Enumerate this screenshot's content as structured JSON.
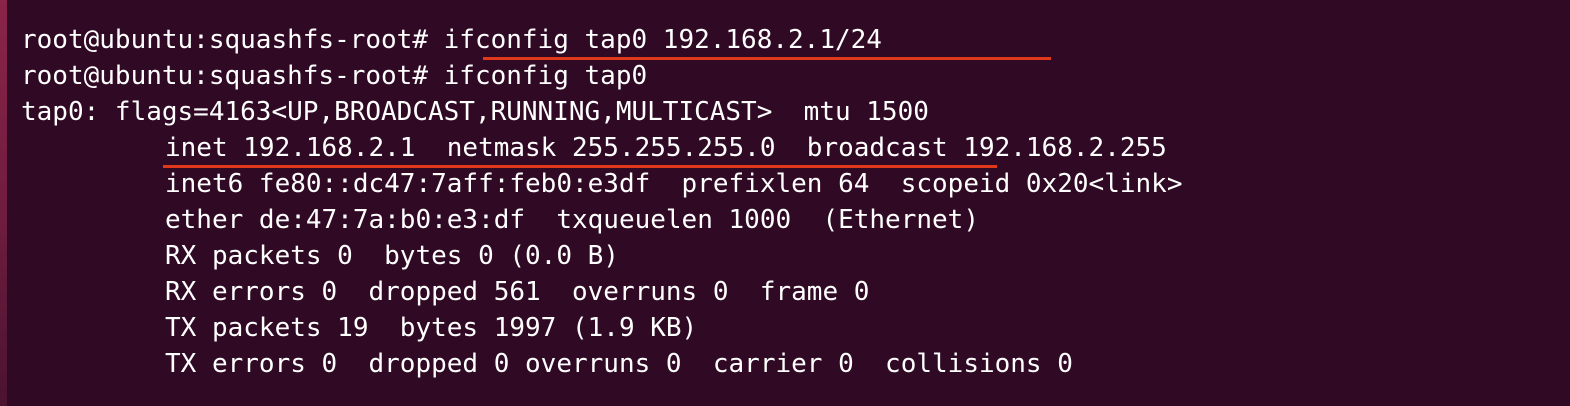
{
  "terminal": {
    "lines": [
      "root@ubuntu:squashfs-root# ifconfig tap0 192.168.2.1/24",
      "root@ubuntu:squashfs-root# ifconfig tap0",
      "tap0: flags=4163<UP,BROADCAST,RUNNING,MULTICAST>  mtu 1500",
      "inet 192.168.2.1  netmask 255.255.255.0  broadcast 192.168.2.255",
      "inet6 fe80::dc47:7aff:feb0:e3df  prefixlen 64  scopeid 0x20<link>",
      "ether de:47:7a:b0:e3:df  txqueuelen 1000  (Ethernet)",
      "RX packets 0  bytes 0 (0.0 B)",
      "RX errors 0  dropped 561  overruns 0  frame 0",
      "TX packets 19  bytes 1997 (1.9 KB)",
      "TX errors 0  dropped 0 overruns 0  carrier 0  collisions 0"
    ]
  },
  "colors": {
    "background": "#300a24",
    "text": "#ffffff",
    "annotation_underline": "#e0381b"
  }
}
